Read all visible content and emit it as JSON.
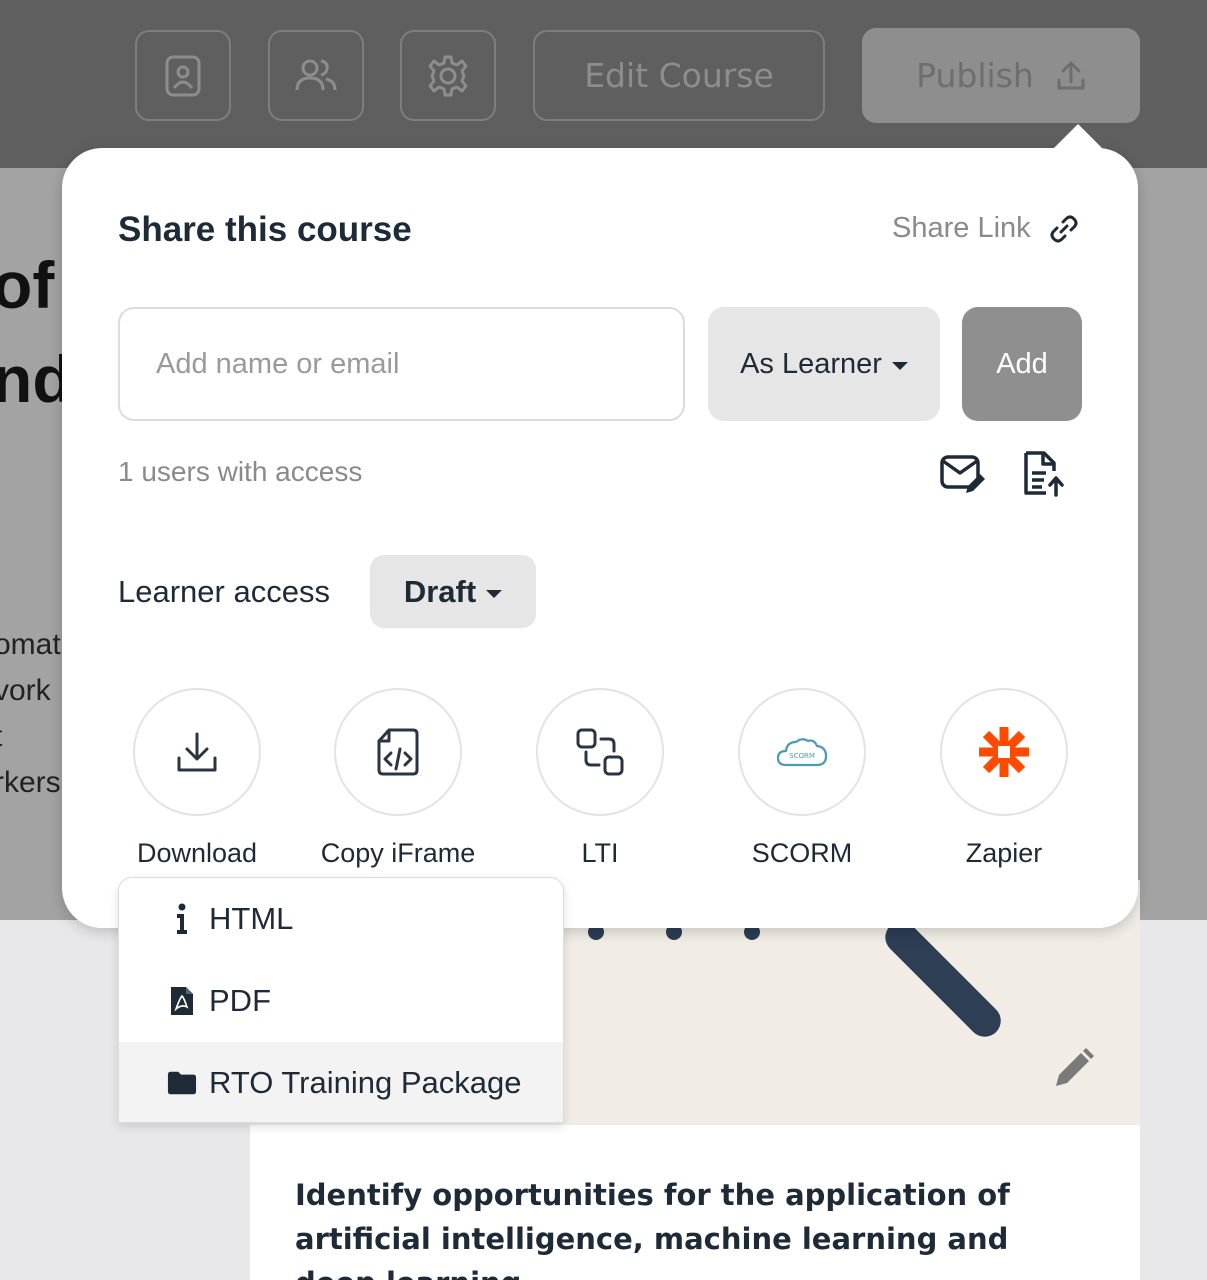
{
  "toolbar": {
    "icon_buttons": [
      "id-badge-icon",
      "users-icon",
      "gear-icon"
    ],
    "edit_label": "Edit Course",
    "publish_label": "Publish"
  },
  "background": {
    "heading_fragments": [
      "of",
      "nd"
    ],
    "body_fragments": [
      "omat",
      "vork",
      "t",
      "rkers"
    ],
    "card_text": "Identify opportunities for the application of artificial intelligence, machine learning and deep learning"
  },
  "share": {
    "title": "Share this course",
    "share_link_label": "Share Link",
    "email_placeholder": "Add name or email",
    "role_selected": "As Learner",
    "add_label": "Add",
    "users_count_text": "1 users with access",
    "learner_access_label": "Learner access",
    "learner_access_value": "Draft",
    "options": [
      {
        "label": "Download",
        "icon": "download-icon"
      },
      {
        "label": "Copy iFrame",
        "icon": "code-file-icon"
      },
      {
        "label": "LTI",
        "icon": "lti-icon"
      },
      {
        "label": "SCORM",
        "icon": "scorm-cloud-icon",
        "icon_text": "SCORM"
      },
      {
        "label": "Zapier",
        "icon": "zapier-icon"
      }
    ]
  },
  "download_menu": {
    "items": [
      {
        "label": "HTML",
        "icon": "info-icon"
      },
      {
        "label": "PDF",
        "icon": "pdf-file-icon"
      },
      {
        "label": "RTO Training Package",
        "icon": "folder-icon"
      }
    ]
  },
  "colors": {
    "zapier_orange": "#ff4a00",
    "scorm_teal": "#4c9bb4",
    "dark_text": "#1f2a37"
  }
}
